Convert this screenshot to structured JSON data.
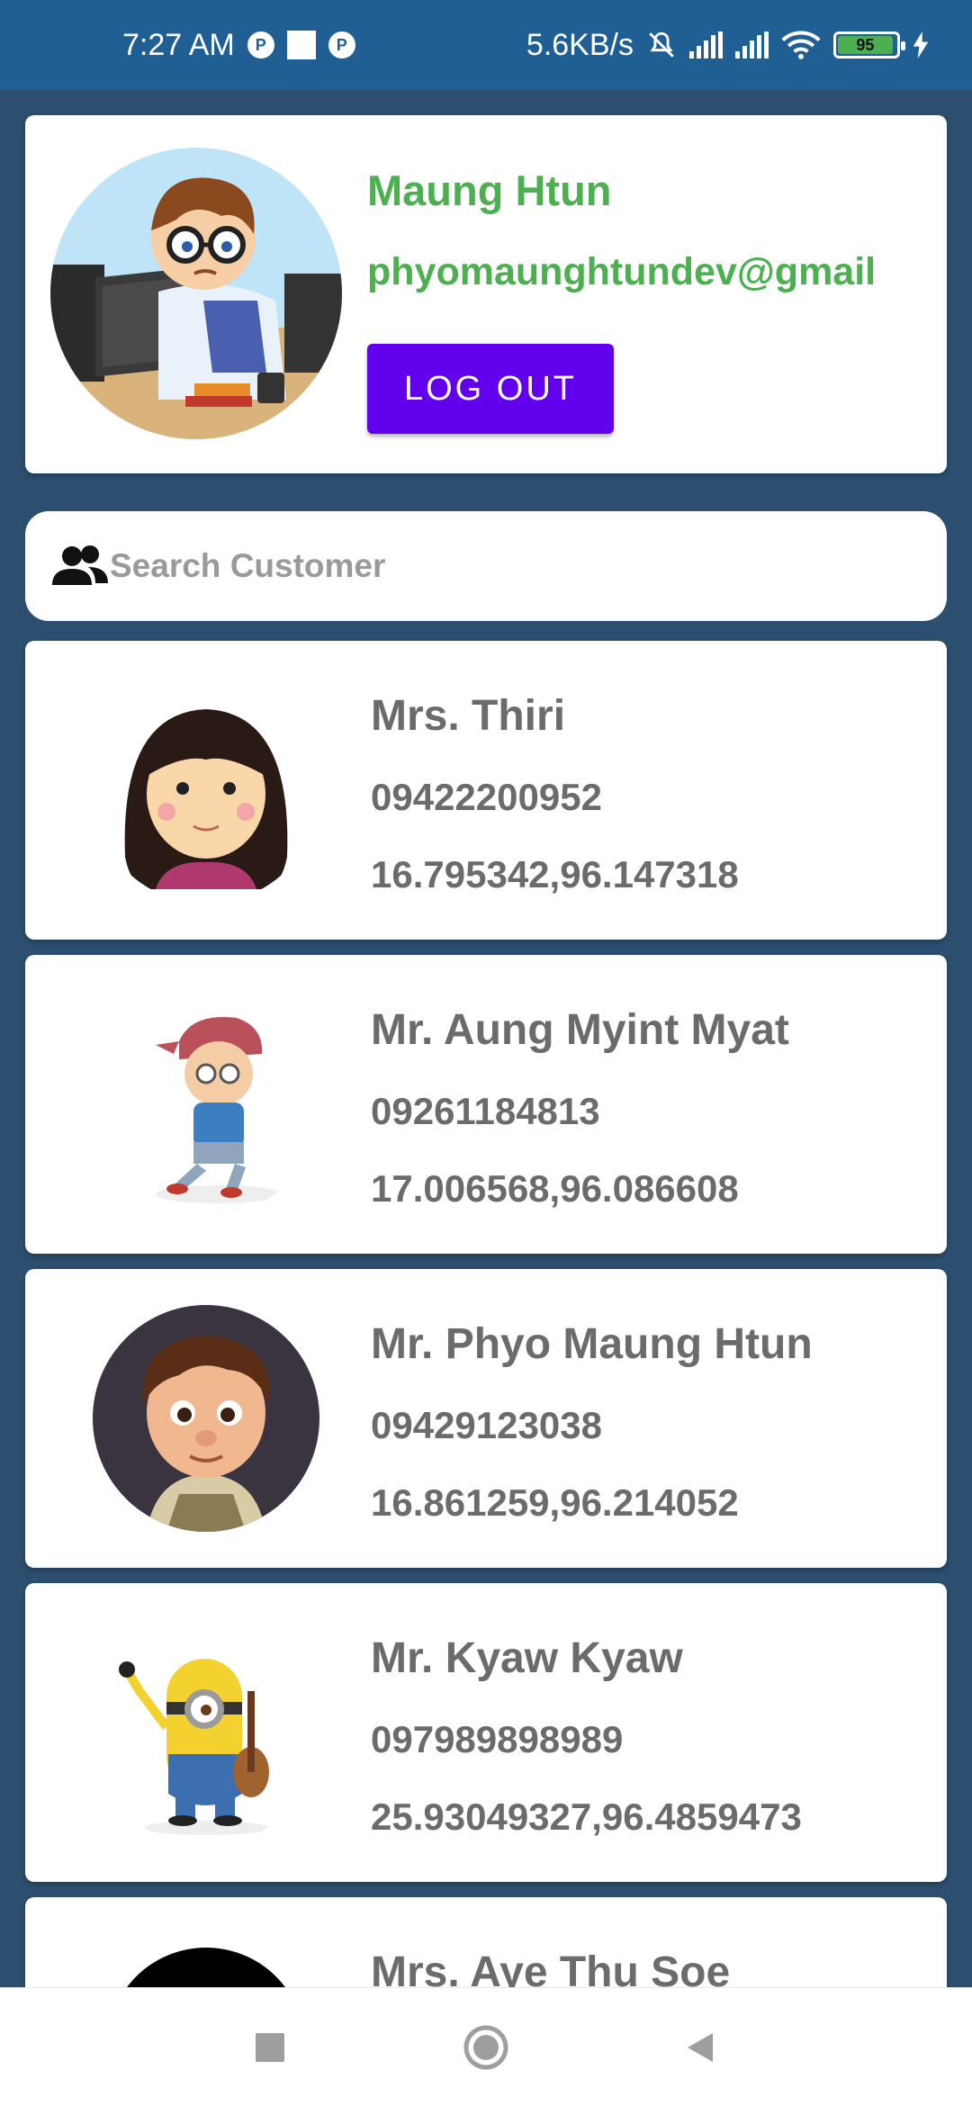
{
  "status_bar": {
    "time": "7:27 AM",
    "net_speed": "5.6KB/s",
    "battery": "95",
    "icons": [
      "notification-icon",
      "square-icon",
      "notification-icon",
      "mute-icon",
      "signal-icon",
      "signal-icon",
      "wifi-icon",
      "battery-icon",
      "charging-icon"
    ]
  },
  "profile": {
    "name": "Maung Htun",
    "email": "phyomaunghtundev@gmail",
    "logout_label": "LOG OUT",
    "accent_color": "#4caf50",
    "button_color": "#6200ee"
  },
  "search": {
    "placeholder": "Search Customer",
    "icon": "people-icon"
  },
  "customers": [
    {
      "name": "Mrs. Thiri",
      "phone": "09422200952",
      "coords": "16.795342,96.147318"
    },
    {
      "name": "Mr. Aung Myint Myat",
      "phone": "09261184813",
      "coords": "17.006568,96.086608"
    },
    {
      "name": "Mr. Phyo Maung Htun",
      "phone": "09429123038",
      "coords": "16.861259,96.214052"
    },
    {
      "name": "Mr. Kyaw Kyaw",
      "phone": "097989898989",
      "coords": "25.93049327,96.4859473"
    },
    {
      "name": "Mrs. Aye Thu Soe",
      "phone": "",
      "coords": ""
    }
  ],
  "nav": {
    "icons": [
      "recents-icon",
      "home-icon",
      "back-icon"
    ]
  },
  "colors": {
    "background": "#2c4f70",
    "status_bar": "#1f5f94",
    "text_gray": "#6b6b6b"
  }
}
